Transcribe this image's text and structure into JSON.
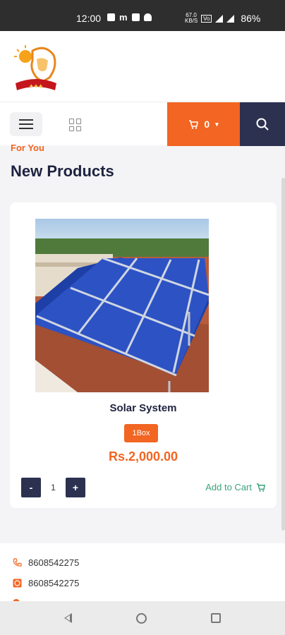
{
  "status_bar": {
    "time": "12:00",
    "battery": "86%",
    "net_speed": "67.0\nKB/S",
    "icons": [
      "image-icon",
      "m-app-icon",
      "square-icon",
      "snapchat-icon",
      "volte-icon",
      "wifi-icon",
      "signal-icon"
    ]
  },
  "header": {
    "logo": "brand-logo"
  },
  "toolbar": {
    "cart_count": "0",
    "menu_icon": "menu-icon",
    "grid_icon": "grid-icon",
    "search_icon": "search-icon"
  },
  "section": {
    "eyebrow": "For You",
    "title": "New Products"
  },
  "product": {
    "name": "Solar System",
    "variant": "1Box",
    "price": "Rs.2,000.00",
    "qty_minus": "-",
    "qty_value": "1",
    "qty_plus": "+",
    "add_to_cart": "Add to Cart"
  },
  "footer": {
    "phone": "8608542275",
    "whatsapp": "8608542275"
  },
  "colors": {
    "accent": "#f26522",
    "navy": "#2c3150",
    "green": "#3aa37a"
  }
}
